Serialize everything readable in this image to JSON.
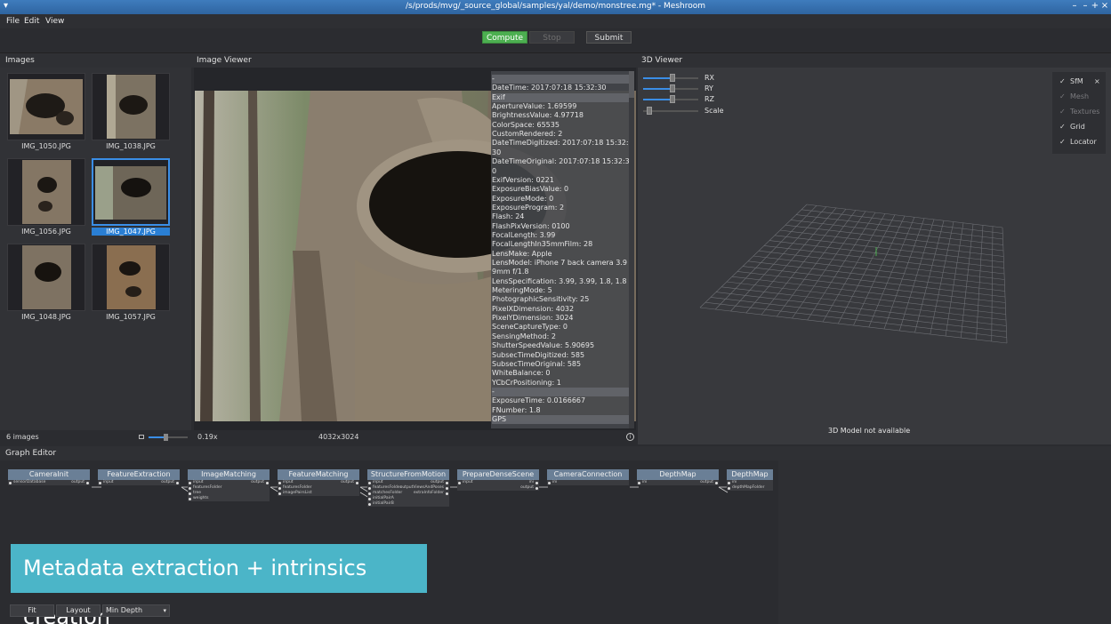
{
  "window": {
    "title": "/s/prods/mvg/_source_global/samples/yal/demo/monstree.mg* - Meshroom",
    "controls": [
      "–",
      "–",
      "+",
      "×"
    ]
  },
  "menu": [
    "File",
    "Edit",
    "View"
  ],
  "toolbar": {
    "compute": "Compute",
    "stop": "Stop",
    "submit": "Submit"
  },
  "images": {
    "header": "Images",
    "items": [
      {
        "name": "IMG_1050.JPG",
        "selected": false
      },
      {
        "name": "IMG_1038.JPG",
        "selected": false
      },
      {
        "name": "IMG_1056.JPG",
        "selected": false
      },
      {
        "name": "IMG_1047.JPG",
        "selected": true
      },
      {
        "name": "IMG_1048.JPG",
        "selected": false
      },
      {
        "name": "IMG_1057.JPG",
        "selected": false
      }
    ],
    "count_label": "6 images"
  },
  "viewer": {
    "header": "Image Viewer",
    "zoom": "0.19x",
    "resolution": "4032x3024",
    "metadata": [
      {
        "t": "-",
        "s": true
      },
      {
        "t": "DateTime: 2017:07:18 15:32:30"
      },
      {
        "t": "Exif",
        "s": true
      },
      {
        "t": "ApertureValue: 1.69599"
      },
      {
        "t": "BrightnessValue: 4.97718"
      },
      {
        "t": "ColorSpace: 65535"
      },
      {
        "t": "CustomRendered: 2"
      },
      {
        "t": "DateTimeDigitized: 2017:07:18 15:32:"
      },
      {
        "t": "30"
      },
      {
        "t": "DateTimeOriginal: 2017:07:18 15:32:3"
      },
      {
        "t": "0"
      },
      {
        "t": "ExifVersion: 0221"
      },
      {
        "t": "ExposureBiasValue: 0"
      },
      {
        "t": "ExposureMode: 0"
      },
      {
        "t": "ExposureProgram: 2"
      },
      {
        "t": "Flash: 24"
      },
      {
        "t": "FlashPixVersion: 0100"
      },
      {
        "t": "FocalLength: 3.99"
      },
      {
        "t": "FocalLengthIn35mmFilm: 28"
      },
      {
        "t": "LensMake: Apple"
      },
      {
        "t": "LensModel: iPhone 7 back camera 3.9"
      },
      {
        "t": "9mm f/1.8"
      },
      {
        "t": "LensSpecification: 3.99, 3.99, 1.8, 1.8"
      },
      {
        "t": "MeteringMode: 5"
      },
      {
        "t": "PhotographicSensitivity: 25"
      },
      {
        "t": "PixelXDimension: 4032"
      },
      {
        "t": "PixelYDimension: 3024"
      },
      {
        "t": "SceneCaptureType: 0"
      },
      {
        "t": "SensingMethod: 2"
      },
      {
        "t": "ShutterSpeedValue: 5.90695"
      },
      {
        "t": "SubsecTimeDigitized: 585"
      },
      {
        "t": "SubsecTimeOriginal: 585"
      },
      {
        "t": "WhiteBalance: 0"
      },
      {
        "t": "YCbCrPositioning: 1"
      },
      {
        "t": "-",
        "s": true
      },
      {
        "t": "ExposureTime: 0.0166667"
      },
      {
        "t": "FNumber: 1.8"
      },
      {
        "t": "GPS",
        "s": true
      }
    ]
  },
  "viewer3d": {
    "header": "3D Viewer",
    "sliders": [
      {
        "label": "RX",
        "value": 0.5
      },
      {
        "label": "RY",
        "value": 0.5
      },
      {
        "label": "RZ",
        "value": 0.5
      },
      {
        "label": "Scale",
        "value": 0.0
      }
    ],
    "layers": [
      {
        "name": "SfM",
        "checked": true,
        "enabled": true,
        "closable": true
      },
      {
        "name": "Mesh",
        "checked": true,
        "enabled": false
      },
      {
        "name": "Textures",
        "checked": true,
        "enabled": false
      },
      {
        "name": "Grid",
        "checked": true,
        "enabled": true
      },
      {
        "name": "Locator",
        "checked": true,
        "enabled": true
      }
    ],
    "status": "3D Model not available"
  },
  "graph": {
    "header": "Graph Editor",
    "nodes": [
      {
        "name": "CameraInit",
        "inputs": [
          "sensorDatabase"
        ],
        "outputs": [
          "output"
        ]
      },
      {
        "name": "FeatureExtraction",
        "inputs": [
          "input"
        ],
        "outputs": [
          "output"
        ]
      },
      {
        "name": "ImageMatching",
        "inputs": [
          "input",
          "featuresFolder",
          "tree",
          "weights"
        ],
        "outputs": [
          "output"
        ]
      },
      {
        "name": "FeatureMatching",
        "inputs": [
          "input",
          "featuresFolder",
          "imagePairsList"
        ],
        "outputs": [
          "output"
        ]
      },
      {
        "name": "StructureFromMotion",
        "inputs": [
          "input",
          "featuresFolder",
          "matchesFolder",
          "initialPairA",
          "initialPairB"
        ],
        "outputs": [
          "output",
          "outputViewsAndPoses",
          "extraInfoFolder"
        ]
      },
      {
        "name": "PrepareDenseScene",
        "inputs": [
          "input"
        ],
        "outputs": [
          "ini",
          "output"
        ]
      },
      {
        "name": "CameraConnection",
        "inputs": [
          "ini"
        ],
        "outputs": []
      },
      {
        "name": "DepthMap",
        "inputs": [
          "ini"
        ],
        "outputs": [
          "output"
        ]
      },
      {
        "name": "DepthMap",
        "inputs": [
          "ini",
          "depthMapFolder"
        ],
        "outputs": []
      }
    ],
    "banner": "Metadata extraction + intrinsics creation",
    "buttons": {
      "fit": "Fit",
      "layout": "Layout",
      "depth": "Min Depth"
    }
  },
  "colors": {
    "accent": "#3a8ee6",
    "compute": "#4caf50",
    "banner": "#4bb5c8",
    "node_header": "#6a7f96"
  }
}
